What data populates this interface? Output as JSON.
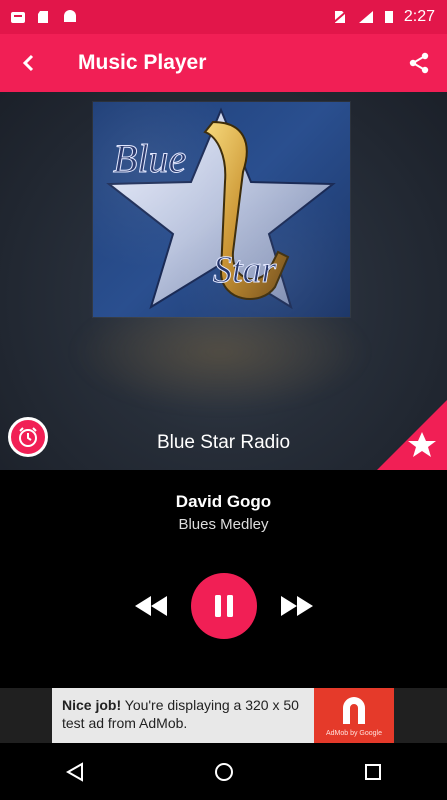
{
  "status_bar": {
    "time": "2:27"
  },
  "app_bar": {
    "title": "Music Player"
  },
  "station": {
    "name": "Blue Star Radio"
  },
  "track": {
    "artist": "David Gogo",
    "song": "Blues Medley"
  },
  "ad": {
    "headline": "Nice job!",
    "body": " You're displaying a 320 x 50 test ad from AdMob.",
    "logo_caption": "AdMob by Google"
  },
  "colors": {
    "accent": "#f11f55",
    "status": "#e2164a"
  },
  "icons": [
    "back-arrow-icon",
    "share-icon",
    "alarm-clock-icon",
    "star-icon",
    "rewind-icon",
    "pause-icon",
    "fast-forward-icon",
    "nav-back-icon",
    "nav-home-icon",
    "nav-recents-icon"
  ]
}
